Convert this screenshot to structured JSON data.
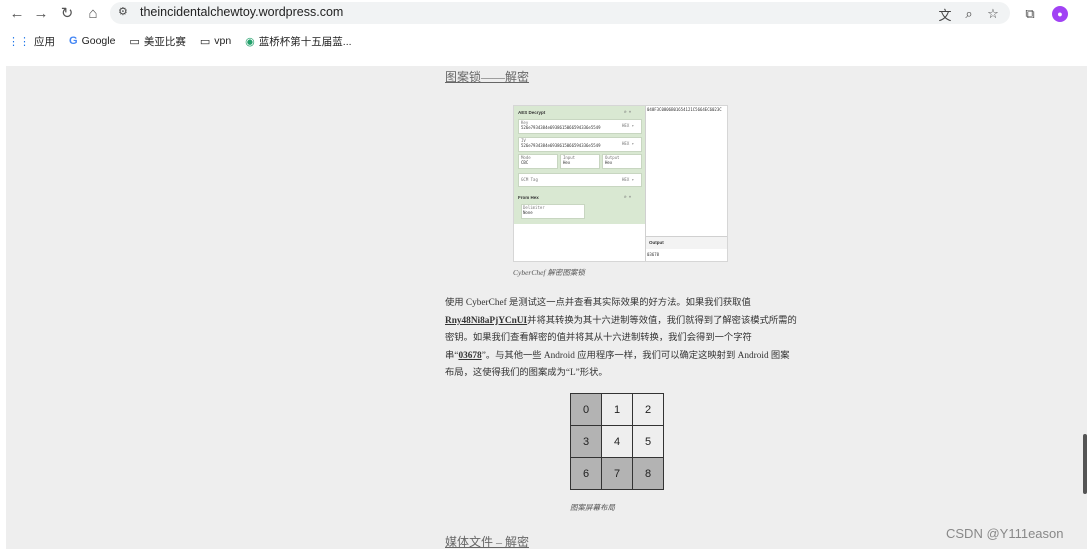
{
  "browser": {
    "url": "theincidentalchewtoy.wordpress.com",
    "bookmarks": [
      {
        "icon": "apps-icon",
        "label": "应用"
      },
      {
        "icon": "google-icon",
        "label": "Google"
      },
      {
        "icon": "folder-icon",
        "label": "美亚比赛"
      },
      {
        "icon": "folder-icon",
        "label": "vpn"
      },
      {
        "icon": "globe-icon",
        "label": "蓝桥杯第十五届蓝..."
      }
    ]
  },
  "article": {
    "section_title": "图案锁——解密",
    "figure_caption": "CyberChef 解密图案锁",
    "paragraph_parts": [
      "使用 CyberChef 是测试这一点并查看其实际效果的好方法。如果我们获取值",
      "Rny48Ni8aPjYCnUI",
      "并将其转换为其十六进制等效值，我们就得到了解密该模式所需的密钥。如果我们查看解密的值并将其从十六进制转换，我们会得到一个字符串“",
      "03678",
      "”。与其他一些 Android 应用程序一样，我们可以确定这映射到 Android 图案布局，这使得我们的图案成为“L”形状。"
    ],
    "grid_cells": [
      "0",
      "1",
      "2",
      "3",
      "4",
      "5",
      "6",
      "7",
      "8"
    ],
    "grid_highlight": [
      0,
      3,
      6,
      7,
      8
    ],
    "grid_caption": "图案屏幕布局",
    "next_section_title": "媒体文件 – 解密"
  },
  "cyberchef": {
    "title": "AES Decrypt",
    "key_label": "Key",
    "key_value": "526e7934384e6938615066594336e5549",
    "key_encoding": "HEX ▾",
    "iv_label": "IV",
    "iv_value": "526e7934384e6938615066594336e5549",
    "iv_encoding": "HEX ▾",
    "mode_label": "Mode",
    "mode_value": "CBC",
    "input_label": "Input",
    "input_value": "Hex",
    "output_label": "Output",
    "output_value": "Hex",
    "gcm_label": "GCM Tag",
    "gcm_encoding": "HEX ▾",
    "from_hex_title": "From Hex",
    "delimiter_label": "Delimiter",
    "delimiter_value": "None",
    "input_text": "048F3C0806B01654121C5664EC6023C",
    "output_heading": "Output",
    "output_result": "03678"
  },
  "watermark": "CSDN @Y111eason"
}
